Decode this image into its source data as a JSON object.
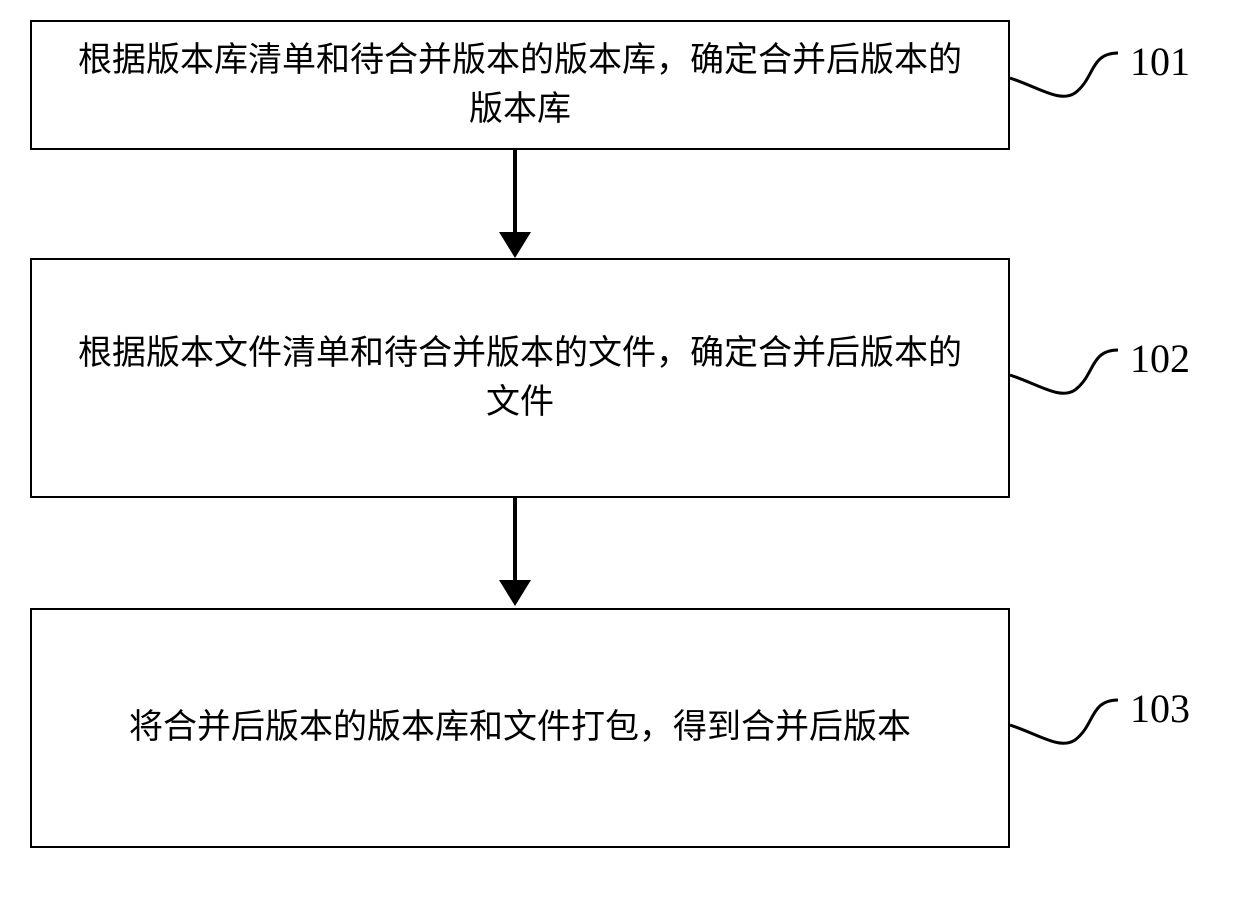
{
  "steps": [
    {
      "id": "101",
      "text": "根据版本库清单和待合并版本的版本库，确定合并后版本的版本库",
      "label": "101"
    },
    {
      "id": "102",
      "text": "根据版本文件清单和待合并版本的文件，确定合并后版本的文件",
      "label": "102"
    },
    {
      "id": "103",
      "text": "将合并后版本的版本库和文件打包，得到合并后版本",
      "label": "103"
    }
  ]
}
